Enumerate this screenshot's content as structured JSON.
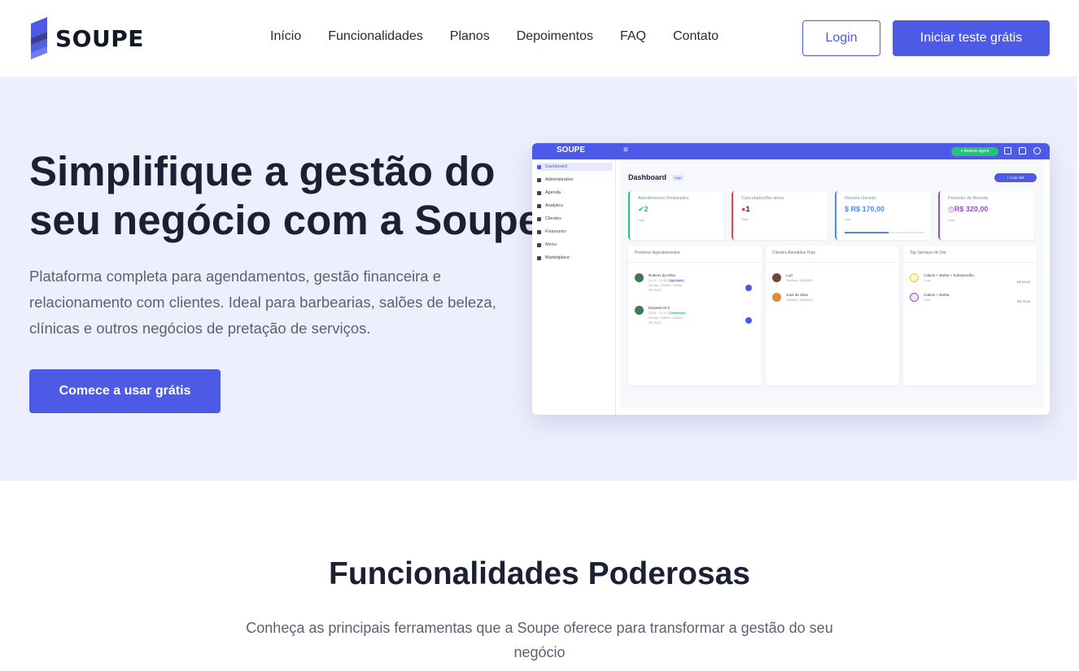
{
  "brand": {
    "name": "SOUPE",
    "accent": "#4c5ae6"
  },
  "nav": {
    "links": [
      "Início",
      "Funcionalidades",
      "Planos",
      "Depoimentos",
      "FAQ",
      "Contato"
    ],
    "login": "Login",
    "trial": "Iniciar teste grátis"
  },
  "hero": {
    "title": "Simplifique a gestão do seu negócio com a Soupe",
    "subtitle": "Plataforma completa para agendamentos, gestão financeira e relacionamento com clientes. Ideal para barbearias, salões de beleza, clínicas e outros negócios de pretação de serviços.",
    "cta": "Comece a usar grátis"
  },
  "mockup": {
    "logo": "SOUPE",
    "menu_icon": "≡",
    "top_button": "+ Assinar agora",
    "sidebar": [
      "Dashboard",
      "Administrativo",
      "Agenda",
      "Analytics",
      "Clientes",
      "Financeiro",
      "Menu",
      "Marketplace"
    ],
    "title": "Dashboard",
    "badge": "Hoje",
    "action": "+ Criar link",
    "cards": [
      {
        "label": "Atendimentos Realizados",
        "value": "2",
        "foot": "Hoje",
        "color": "#27c27a"
      },
      {
        "label": "Cancelados/No-show",
        "value": "1",
        "foot": "Hoje",
        "color": "#e0474c"
      },
      {
        "label": "Receita Gerada",
        "value": "R$ 170,00",
        "foot": "Hoje",
        "color": "#4c8af0"
      },
      {
        "label": "Previsão de Receita",
        "value": "R$ 320,00",
        "foot": "Hoje",
        "color": "#9b4ad6"
      }
    ],
    "panels": {
      "appointments": {
        "title": "Próximos Agendamentos",
        "items": [
          {
            "name": "Rubens da Silva",
            "time": "10:15 - 10:45",
            "tag": "Agendado",
            "service": "Serviço: Cabelo + Barba",
            "price": "R$ 75,00"
          },
          {
            "name": "Eduardo M S",
            "time": "10:45 - 11:15",
            "tag": "Confirmado",
            "service": "Serviço: Cabelo + Barba",
            "price": "R$ 75,00"
          }
        ]
      },
      "clients": {
        "title": "Clientes Atendidos Hoje",
        "items": [
          {
            "name": "Luiz",
            "sub": "Telefone: 40028922"
          },
          {
            "name": "José da Silva",
            "sub": "Telefone: 40028922"
          }
        ]
      },
      "services": {
        "title": "Top Serviços do Dia",
        "items": [
          {
            "name": "Cabelo + Barba + Sobrancelha",
            "sub": "1 uso",
            "price": "R$ 95,00"
          },
          {
            "name": "Cabelo + Barba",
            "sub": "1 uso",
            "price": "R$ 75,00"
          }
        ]
      }
    }
  },
  "features": {
    "title": "Funcionalidades Poderosas",
    "subtitle": "Conheça as principais ferramentas que a Soupe oferece para transformar a gestão do seu negócio"
  }
}
